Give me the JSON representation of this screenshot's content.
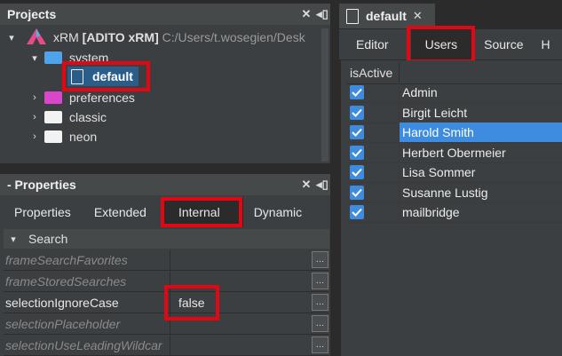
{
  "projects": {
    "title": "Projects",
    "root": {
      "prefix": "xRM ",
      "bold": "[ADITO xRM]",
      "path": " C:/Users/t.wosegien/Desk"
    },
    "items": [
      {
        "label": "system",
        "color": "#4fa3e8"
      },
      {
        "label": "default"
      },
      {
        "label": "preferences",
        "color": "#d946c9"
      },
      {
        "label": "classic",
        "color": "#f2f2f2"
      },
      {
        "label": "neon",
        "color": "#f2f2f2"
      }
    ]
  },
  "properties": {
    "title": "- Properties",
    "tabs": [
      "Properties",
      "Extended",
      "Internal",
      "Dynamic"
    ],
    "section": "Search",
    "rows": [
      {
        "name": "frameSearchFavorites",
        "value": ""
      },
      {
        "name": "frameStoredSearches",
        "value": ""
      },
      {
        "name": "selectionIgnoreCase",
        "value": "false"
      },
      {
        "name": "selectionPlaceholder",
        "value": ""
      },
      {
        "name": "selectionUseLeadingWildcar",
        "value": ""
      }
    ]
  },
  "editor": {
    "tab_title": "default",
    "tabs": [
      "Editor",
      "Users",
      "Source",
      "H"
    ],
    "column": "isActive",
    "users": [
      "Admin",
      "Birgit Leicht",
      "Harold Smith",
      "Herbert Obermeier",
      "Lisa Sommer",
      "Susanne Lustig",
      "mailbridge"
    ],
    "selected_index": 2
  },
  "colors": {
    "highlight": "#e30613",
    "selection": "#3d8ce0",
    "panel": "#3c3f41"
  }
}
